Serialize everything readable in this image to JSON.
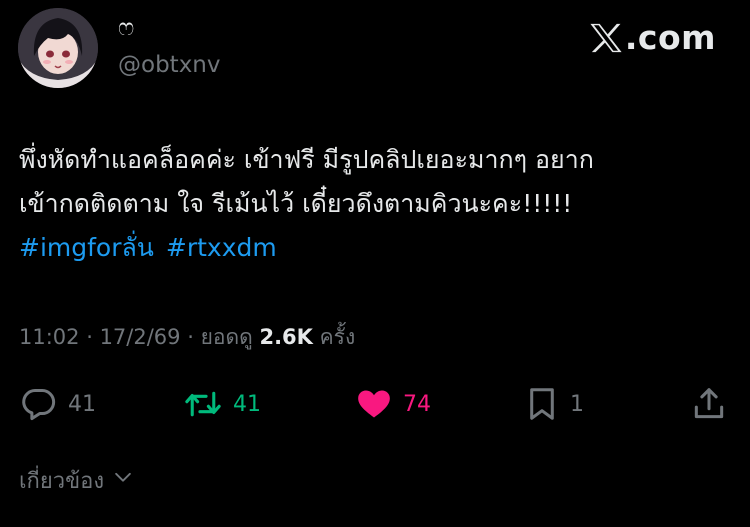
{
  "author": {
    "display_name": "ෆ",
    "handle": "@obtxnv"
  },
  "brand": {
    "text": ".com",
    "logo_icon": "x-logo-icon"
  },
  "post": {
    "lines": [
      "พึ่งหัดทำแอคล็อคค่ะ เข้าฟรี มีรูปคลิปเยอะมากๆ อยาก",
      "เข้ากดติดตาม ใจ รีเม้นไว้ เดี๋ยวดึงตามคิวนะคะ!!!!!"
    ],
    "hashtags": [
      "#imgforลั่น",
      "#rtxxdm"
    ]
  },
  "meta": {
    "time": "11:02",
    "separator": " · ",
    "date": "17/2/69",
    "views_prefix": "ยอดดู",
    "views_count": "2.6K",
    "views_suffix": "ครั้ง"
  },
  "actions": {
    "reply_count": "41",
    "repost_count": "41",
    "like_count": "74",
    "bookmark_count": "1"
  },
  "related": {
    "label": "เกี่ยวข้อง"
  },
  "colors": {
    "background": "#000000",
    "text": "#e7e9ea",
    "muted": "#71767b",
    "link": "#1d9bf0",
    "repost": "#00ba7c",
    "like": "#f91880"
  }
}
